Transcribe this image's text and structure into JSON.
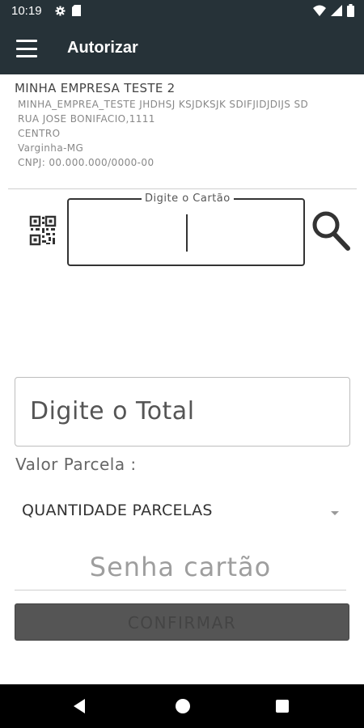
{
  "status_bar": {
    "time": "10:19",
    "left_icons": [
      "gear-icon",
      "sd-card-icon"
    ],
    "right_icons": [
      "wifi-icon",
      "signal-icon",
      "battery-icon"
    ]
  },
  "app_bar": {
    "title": "Autorizar",
    "menu_icon": "hamburger-menu-icon",
    "background": "#263238"
  },
  "company": {
    "name": "MINHA EMPRESA TESTE 2",
    "lines": [
      "MINHA_EMPREA_TESTE JHDHSJ KSJDKSJK SDIFJIDJDIJS SD",
      "RUA JOSE BONIFACIO,1111",
      "CENTRO",
      "Varginha-MG",
      "CNPJ: 00.000.000/0000-00"
    ]
  },
  "card": {
    "legend": "Digite o Cartão",
    "value": "",
    "qr_icon": "qr-code-icon",
    "search_icon": "search-icon"
  },
  "total": {
    "placeholder": "Digite o Total"
  },
  "valor_parcela": {
    "label": "Valor Parcela :"
  },
  "parcelas": {
    "selected": "QUANTIDADE PARCELAS"
  },
  "senha": {
    "placeholder": "Senha cartão"
  },
  "confirm": {
    "label": "CONFIRMAR"
  },
  "nav": {
    "icons": [
      "back-icon",
      "home-icon",
      "recents-icon"
    ]
  }
}
